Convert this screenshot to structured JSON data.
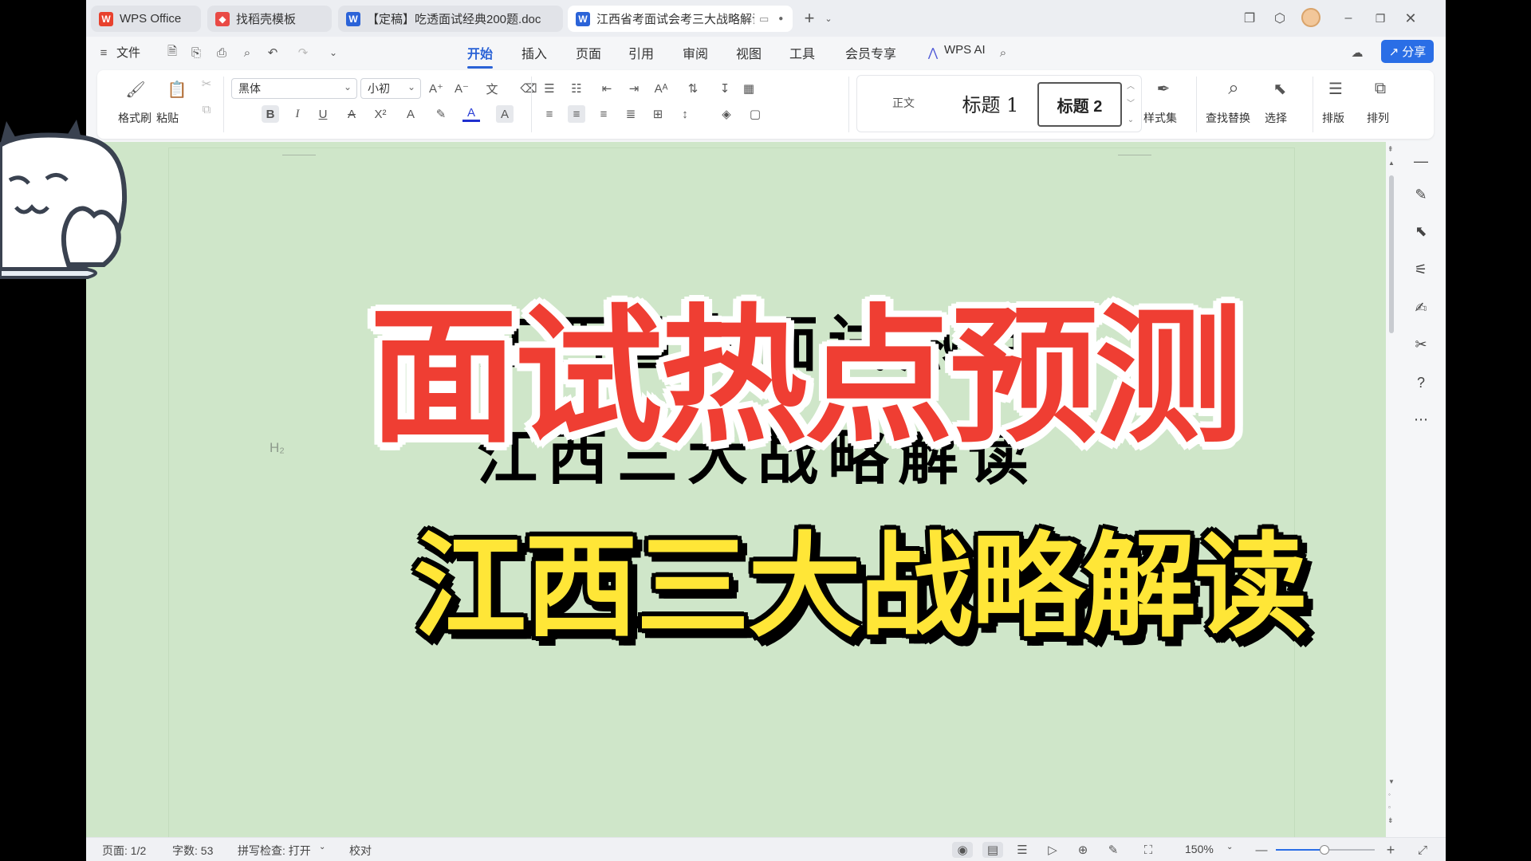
{
  "tabs": [
    {
      "label": "WPS Office",
      "icon": "wps-logo-icon"
    },
    {
      "label": "找稻壳模板",
      "icon": "daoke-icon"
    },
    {
      "label": "【定稿】吃透面试经典200题.doc",
      "icon": "word-doc-icon"
    },
    {
      "label": "江西省考面试会考三大战略解读",
      "icon": "word-doc-icon"
    }
  ],
  "menu": {
    "file": "文件",
    "items": [
      "开始",
      "插入",
      "页面",
      "引用",
      "审阅",
      "视图",
      "工具",
      "会员专享"
    ],
    "active": "开始",
    "ai": "WPS AI",
    "share": "分享"
  },
  "ribbon": {
    "format_painter": "格式刷",
    "paste": "粘贴",
    "font_name": "黑体",
    "font_size": "小初",
    "styles": [
      "正文",
      "标题 1",
      "标题 2"
    ],
    "style_set": "样式集",
    "find_replace": "查找替换",
    "select": "选择",
    "layout": "排版",
    "arrange": "排列"
  },
  "document": {
    "heading_marker": "H₂",
    "ghost_line1": "江西省考面试热点",
    "ghost_line2": "江西三大战略解读",
    "title_red": "面试热点预测",
    "title_yellow": "江西三大战略解读"
  },
  "status": {
    "page": "页面: 1/2",
    "words": "字数: 53",
    "spell": "拼写检查: 打开",
    "proof": "校对",
    "zoom": "150%",
    "zoom_fraction": 0.48
  },
  "colors": {
    "accent": "#2a62d6",
    "doc_bg": "#cfe6c9",
    "title_red": "#ef3e33",
    "title_yellow": "#ffe637"
  }
}
